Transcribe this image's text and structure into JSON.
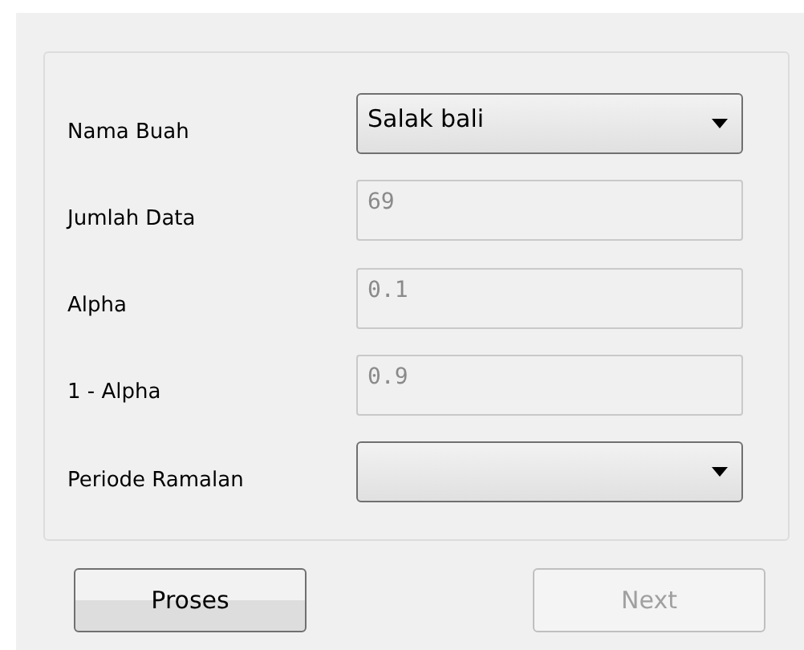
{
  "form": {
    "fields": [
      {
        "label": "Nama Buah",
        "kind": "combo",
        "value": "Salak bali",
        "disabled": false
      },
      {
        "label": "Jumlah Data",
        "kind": "text",
        "value": "69",
        "disabled": true
      },
      {
        "label": "Alpha",
        "kind": "text",
        "value": "0.1",
        "disabled": true
      },
      {
        "label": "1 - Alpha",
        "kind": "text",
        "value": "0.9",
        "disabled": true
      },
      {
        "label": "Periode Ramalan",
        "kind": "combo",
        "disabled": false
      }
    ]
  },
  "buttons": [
    {
      "label": "Proses",
      "disabled": false
    },
    {
      "label": "Next",
      "disabled": true
    }
  ]
}
